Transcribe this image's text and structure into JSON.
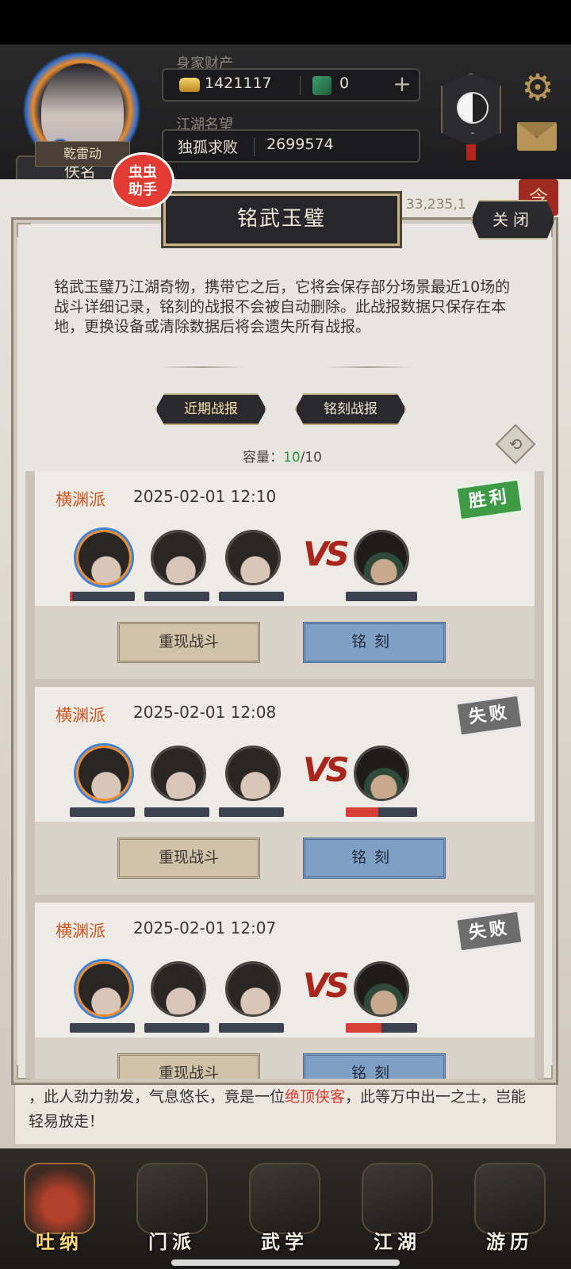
{
  "header": {
    "wealth_label": "身家财产",
    "gold_value": "1421117",
    "jade_value": "0",
    "plus_label": "+",
    "fame_label": "江湖名望",
    "fame_title": "独孤求败",
    "fame_value": "2699574",
    "rank_title": "佚名",
    "skill_name": "乾雷动",
    "gender_symbol": "♂",
    "taiji_dash": "-"
  },
  "helper_badge": {
    "line1": "虫虫",
    "line2": "助手"
  },
  "background": {
    "power_text": "E: 33,235,1",
    "side_tag": "令"
  },
  "modal": {
    "title": "铭武玉璧",
    "close_label": "关闭",
    "description": "铭武玉璧乃江湖奇物，携带它之后，它将会保存部分场景最近10场的战斗详细记录，铭刻的战报不会被自动删除。此战报数据只保存在本地，更换设备或清除数据后将会遗失所有战报。",
    "tabs": [
      {
        "label": "近期战报",
        "active": true
      },
      {
        "label": "铭刻战报",
        "active": false
      }
    ],
    "capacity_label": "容量：",
    "capacity_used": "10",
    "capacity_total": "/10",
    "refresh_glyph": "⟲"
  },
  "battles": [
    {
      "sect": "横渊派",
      "time": "2025-02-01 12:10",
      "result": "胜利",
      "outcome": "win",
      "enemy_hp": 0.0,
      "main_hp": 0.04
    },
    {
      "sect": "横渊派",
      "time": "2025-02-01 12:08",
      "result": "失败",
      "outcome": "lose",
      "enemy_hp": 0.45,
      "main_hp": 0.0
    },
    {
      "sect": "横渊派",
      "time": "2025-02-01 12:07",
      "result": "失败",
      "outcome": "lose",
      "enemy_hp": 0.5,
      "main_hp": 0.0
    }
  ],
  "battle_buttons": {
    "replay": "重现战斗",
    "inscribe": "铭刻"
  },
  "vs_label": "VS",
  "story": {
    "before": "，此人劲力勃发，气息悠长，竟是一位",
    "highlight": "绝顶侠客",
    "after": "，此等万中出一之士，岂能轻易放走！"
  },
  "nav": [
    {
      "label": "吐纳",
      "active": true
    },
    {
      "label": "门派",
      "active": false
    },
    {
      "label": "武学",
      "active": false
    },
    {
      "label": "江湖",
      "active": false
    },
    {
      "label": "游历",
      "active": false
    }
  ],
  "colors": {
    "win_stamp": "#3f9a46",
    "lose_stamp": "#6d6d6d",
    "sect_text": "#c8571f",
    "inscribe_button": "#7f9fc4"
  },
  "icons": [
    "gold-ingot-icon",
    "jade-icon",
    "taiji-icon",
    "gear-icon",
    "mail-icon",
    "refresh-icon",
    "gender-male-icon"
  ]
}
